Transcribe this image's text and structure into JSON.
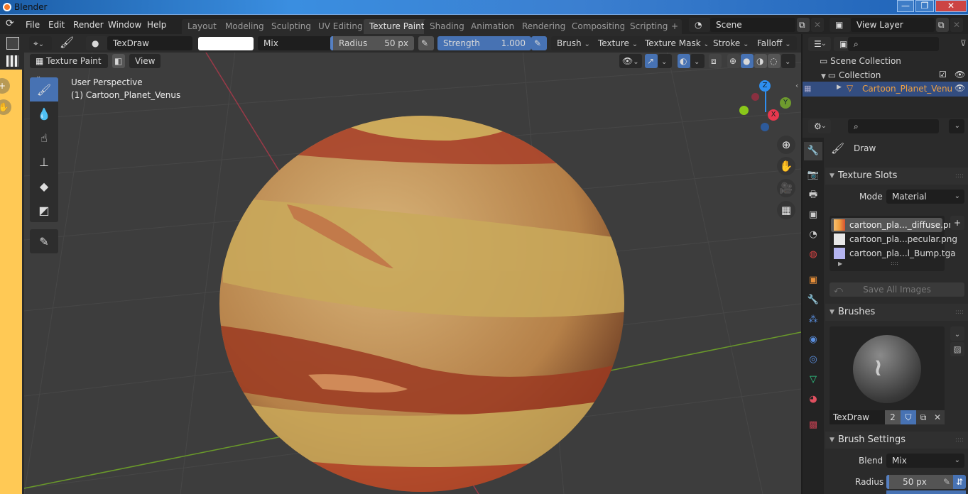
{
  "window": {
    "title": "Blender",
    "controls": {
      "minimize": "—",
      "maximize": "❐",
      "close": "✕"
    }
  },
  "menu": {
    "items": [
      "File",
      "Edit",
      "Render",
      "Window",
      "Help"
    ]
  },
  "workspaces": {
    "tabs": [
      "Layout",
      "Modeling",
      "Sculpting",
      "UV Editing",
      "Texture Paint",
      "Shading",
      "Animation",
      "Rendering",
      "Compositing",
      "Scripting"
    ],
    "active": "Texture Paint",
    "add": "+"
  },
  "scene": {
    "name": "Scene",
    "view_layer": "View Layer"
  },
  "tool_header": {
    "brush_name": "TexDraw",
    "color_hex": "#ffffff",
    "blend": "Mix",
    "radius_label": "Radius",
    "radius_value": "50 px",
    "strength_label": "Strength",
    "strength_value": "1.000",
    "menus": [
      "Brush",
      "Texture",
      "Texture Mask",
      "Stroke",
      "Falloff"
    ]
  },
  "viewport_header": {
    "mode": "Texture Paint",
    "view": "View"
  },
  "viewport": {
    "info_line1": "User Perspective",
    "info_line2": "(1) Cartoon_Planet_Venus",
    "gizmo": {
      "z": "Z",
      "y": "Y",
      "x": "X"
    },
    "colors": {
      "bg": "#3d3d3d",
      "planet_yellow": "#c9a95a",
      "planet_orange": "#c07a50",
      "planet_red": "#a8402a"
    }
  },
  "outliner": {
    "scene_collection": "Scene Collection",
    "collection": "Collection",
    "object": "Cartoon_Planet_Venu"
  },
  "properties": {
    "tool_name": "Draw",
    "texture_slots": {
      "title": "Texture Slots",
      "mode_label": "Mode",
      "mode_value": "Material",
      "slots": [
        {
          "name": "cartoon_pla..._diffuse.png",
          "swatch": "#f0a040"
        },
        {
          "name": "cartoon_pla...pecular.png",
          "swatch": "#e8e8e8"
        },
        {
          "name": "cartoon_pla...l_Bump.tga",
          "swatch": "#b4b4f0"
        }
      ],
      "save_all": "Save All Images"
    },
    "brushes": {
      "title": "Brushes",
      "brush_name": "TexDraw",
      "users": "2"
    },
    "brush_settings": {
      "title": "Brush Settings",
      "blend_label": "Blend",
      "blend_value": "Mix",
      "radius_label": "Radius",
      "radius_value": "50 px"
    }
  }
}
